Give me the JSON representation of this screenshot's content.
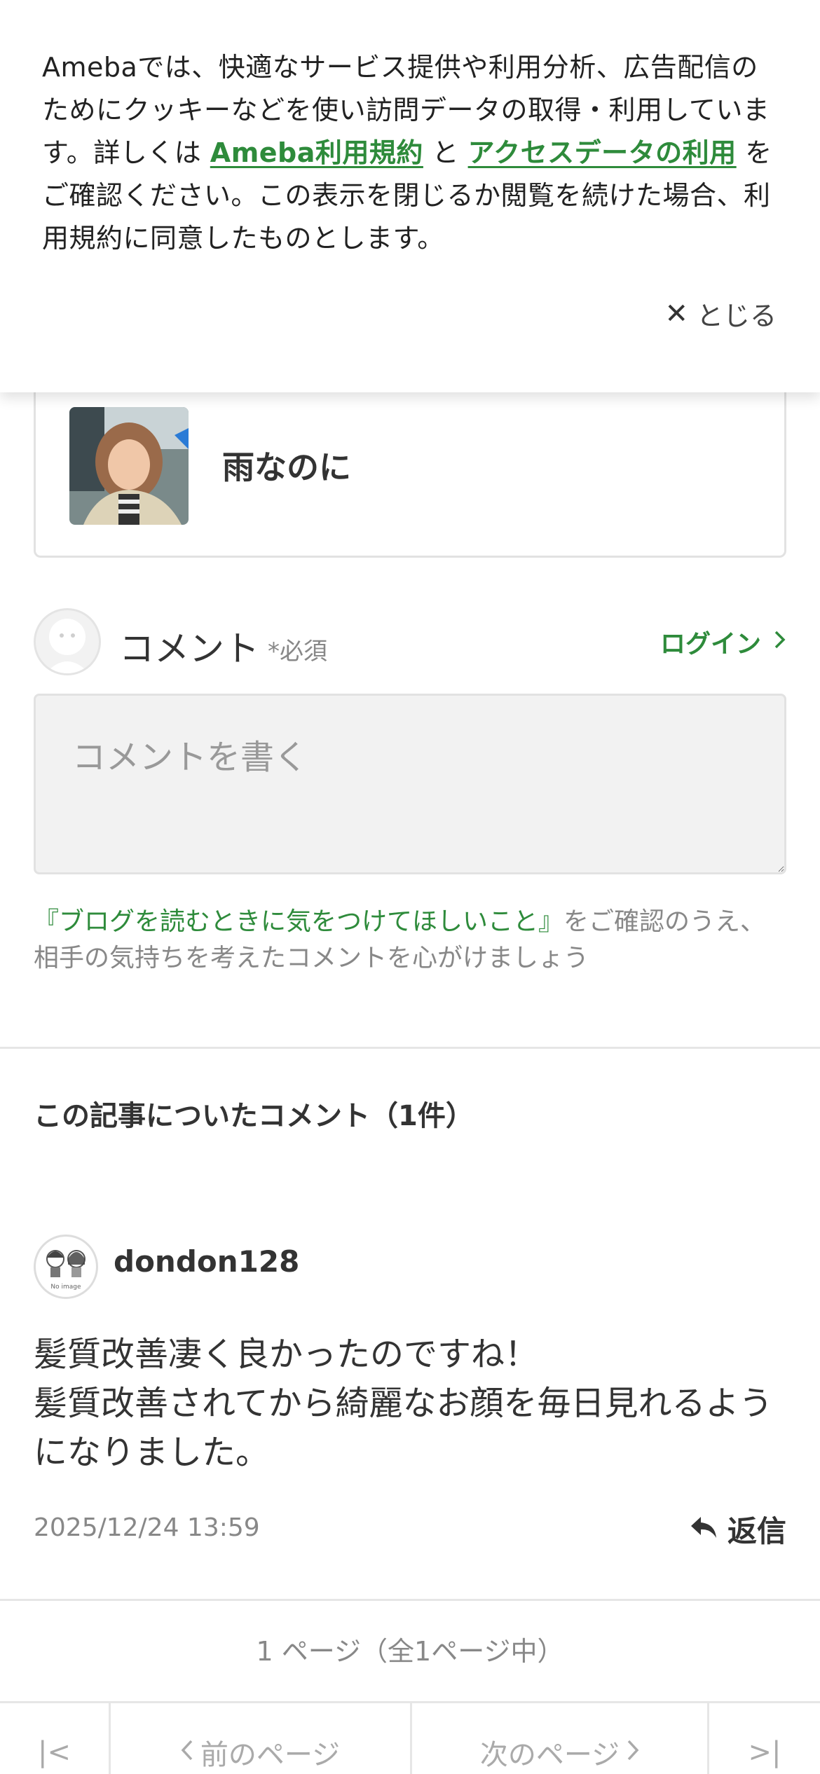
{
  "cookie_banner": {
    "text_before": "Amebaでは、快適なサービス提供や利用分析、広告配信のためにクッキーなどを使い訪問データの取得・利用しています。詳しくは ",
    "link_terms": "Ameba利用規約",
    "text_between": " と ",
    "link_access": "アクセスデータの利用",
    "text_after": " をご確認ください。この表示を閉じるか閲覧を続けた場合、利用規約に同意したものとします。",
    "close_label": "とじる",
    "close_icon": "close-icon"
  },
  "blog_card": {
    "title": "雨なのに"
  },
  "comment_form": {
    "label": "コメント",
    "required": "*必須",
    "login_label": "ログイン",
    "placeholder": "コメントを書く",
    "notice_link": "『ブログを読むときに気をつけてほしいこと』",
    "notice_text": "をご確認のうえ、相手の気持ちを考えたコメントを心がけましょう"
  },
  "comments": {
    "title": "この記事についたコメント（1件）",
    "items": [
      {
        "user": "dondon128",
        "avatar_label": "No image",
        "body_line1": "髪質改善凄く良かったのですね！",
        "body_line2": "髪質改善されてから綺麗なお顔を毎日見れるようになりました。",
        "date": "2025/12/24 13:59",
        "reply_label": "返信"
      }
    ],
    "page_info": "1 ページ（全1ページ中）"
  },
  "pager": {
    "first_label": "|<",
    "prev_label": "前のページ",
    "next_label": "次のページ",
    "last_label": ">|"
  },
  "colors": {
    "accent_green": "#2e8b3b",
    "text": "#333333",
    "muted": "#888888",
    "border": "#e2e2e2"
  }
}
